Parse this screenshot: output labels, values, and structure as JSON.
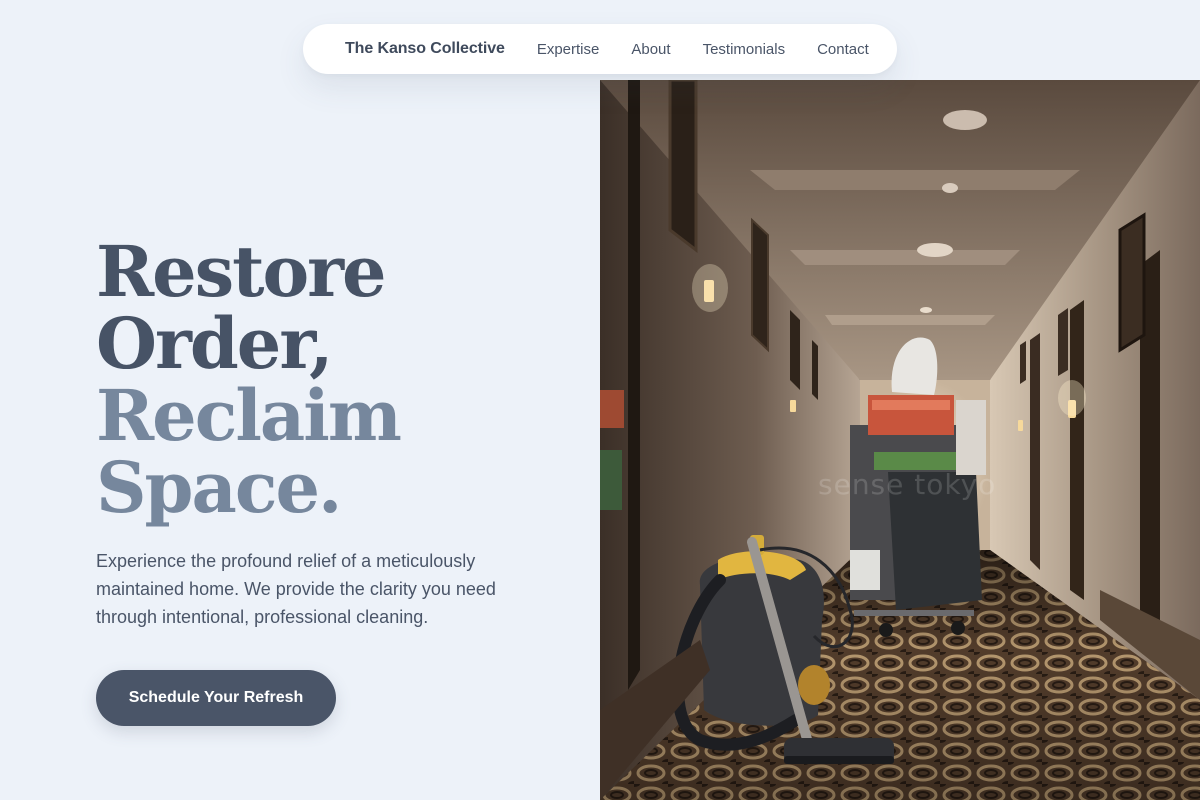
{
  "nav": {
    "brand": "The Kanso Collective",
    "links": [
      {
        "label": "Expertise"
      },
      {
        "label": "About"
      },
      {
        "label": "Testimonials"
      },
      {
        "label": "Contact"
      }
    ]
  },
  "hero": {
    "headline": {
      "line1": "Restore",
      "line2": "Order,",
      "line3": "Reclaim",
      "line4": "Space."
    },
    "subtext": "Experience the profound relief of a meticulously maintained home. We provide the clarity you need through intentional, professional cleaning.",
    "cta_label": "Schedule Your Refresh",
    "image": {
      "description_icon": "hotel-corridor-photo",
      "watermark": "sense tokyo"
    }
  },
  "colors": {
    "background": "#edf2f9",
    "headline_dark": "#475366",
    "headline_light": "#76879d",
    "text": "#4a5568",
    "button": "#4a5568",
    "button_text": "#ffffff",
    "nav_bg": "#ffffff"
  }
}
